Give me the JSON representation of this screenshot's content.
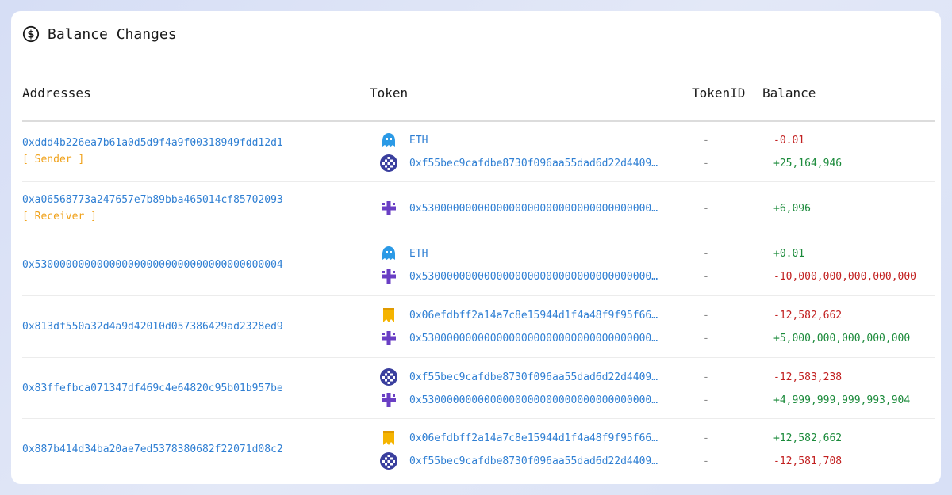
{
  "title": "Balance Changes",
  "columns": {
    "addresses": "Addresses",
    "token": "Token",
    "token_id": "TokenID",
    "balance": "Balance"
  },
  "rows": [
    {
      "address": "0xddd4b226ea7b61a0d5d9f4a9f00318949fdd12d1",
      "tag": "[ Sender ]",
      "tokens": [
        {
          "icon": "eth",
          "name": "ETH",
          "token_id": "-",
          "balance": "-0.01",
          "sign": "neg"
        },
        {
          "icon": "checker-token",
          "name": "0xf55bec9cafdbe8730f096aa55dad6d22d4409…",
          "token_id": "-",
          "balance": "+25,164,946",
          "sign": "pos"
        }
      ]
    },
    {
      "address": "0xa06568773a247657e7b89bba465014cf85702093",
      "tag": "[ Receiver ]",
      "tokens": [
        {
          "icon": "cross-token",
          "name": "0x5300000000000000000000000000000000000…",
          "token_id": "-",
          "balance": "+6,096",
          "sign": "pos"
        }
      ]
    },
    {
      "address": "0x5300000000000000000000000000000000000004",
      "tag": "",
      "tokens": [
        {
          "icon": "eth",
          "name": "ETH",
          "token_id": "-",
          "balance": "+0.01",
          "sign": "pos"
        },
        {
          "icon": "cross-token",
          "name": "0x5300000000000000000000000000000000000…",
          "token_id": "-",
          "balance": "-10,000,000,000,000,000",
          "sign": "neg"
        }
      ]
    },
    {
      "address": "0x813df550a32d4a9d42010d057386429ad2328ed9",
      "tag": "",
      "tokens": [
        {
          "icon": "yellow-token",
          "name": "0x06efdbff2a14a7c8e15944d1f4a48f9f95f66…",
          "token_id": "-",
          "balance": "-12,582,662",
          "sign": "neg"
        },
        {
          "icon": "cross-token",
          "name": "0x5300000000000000000000000000000000000…",
          "token_id": "-",
          "balance": "+5,000,000,000,000,000",
          "sign": "pos"
        }
      ]
    },
    {
      "address": "0x83ffefbca071347df469c4e64820c95b01b957be",
      "tag": "",
      "tokens": [
        {
          "icon": "checker-token",
          "name": "0xf55bec9cafdbe8730f096aa55dad6d22d4409…",
          "token_id": "-",
          "balance": "-12,583,238",
          "sign": "neg"
        },
        {
          "icon": "cross-token",
          "name": "0x5300000000000000000000000000000000000…",
          "token_id": "-",
          "balance": "+4,999,999,999,993,904",
          "sign": "pos"
        }
      ]
    },
    {
      "address": "0x887b414d34ba20ae7ed5378380682f22071d08c2",
      "tag": "",
      "tokens": [
        {
          "icon": "yellow-token",
          "name": "0x06efdbff2a14a7c8e15944d1f4a48f9f95f66…",
          "token_id": "-",
          "balance": "+12,582,662",
          "sign": "pos"
        },
        {
          "icon": "checker-token",
          "name": "0xf55bec9cafdbe8730f096aa55dad6d22d4409…",
          "token_id": "-",
          "balance": "-12,581,708",
          "sign": "neg"
        }
      ]
    }
  ],
  "colors": {
    "link": "#2f7fd3",
    "tag": "#f0a21b",
    "negative": "#c22020",
    "positive": "#1a8a3a"
  }
}
